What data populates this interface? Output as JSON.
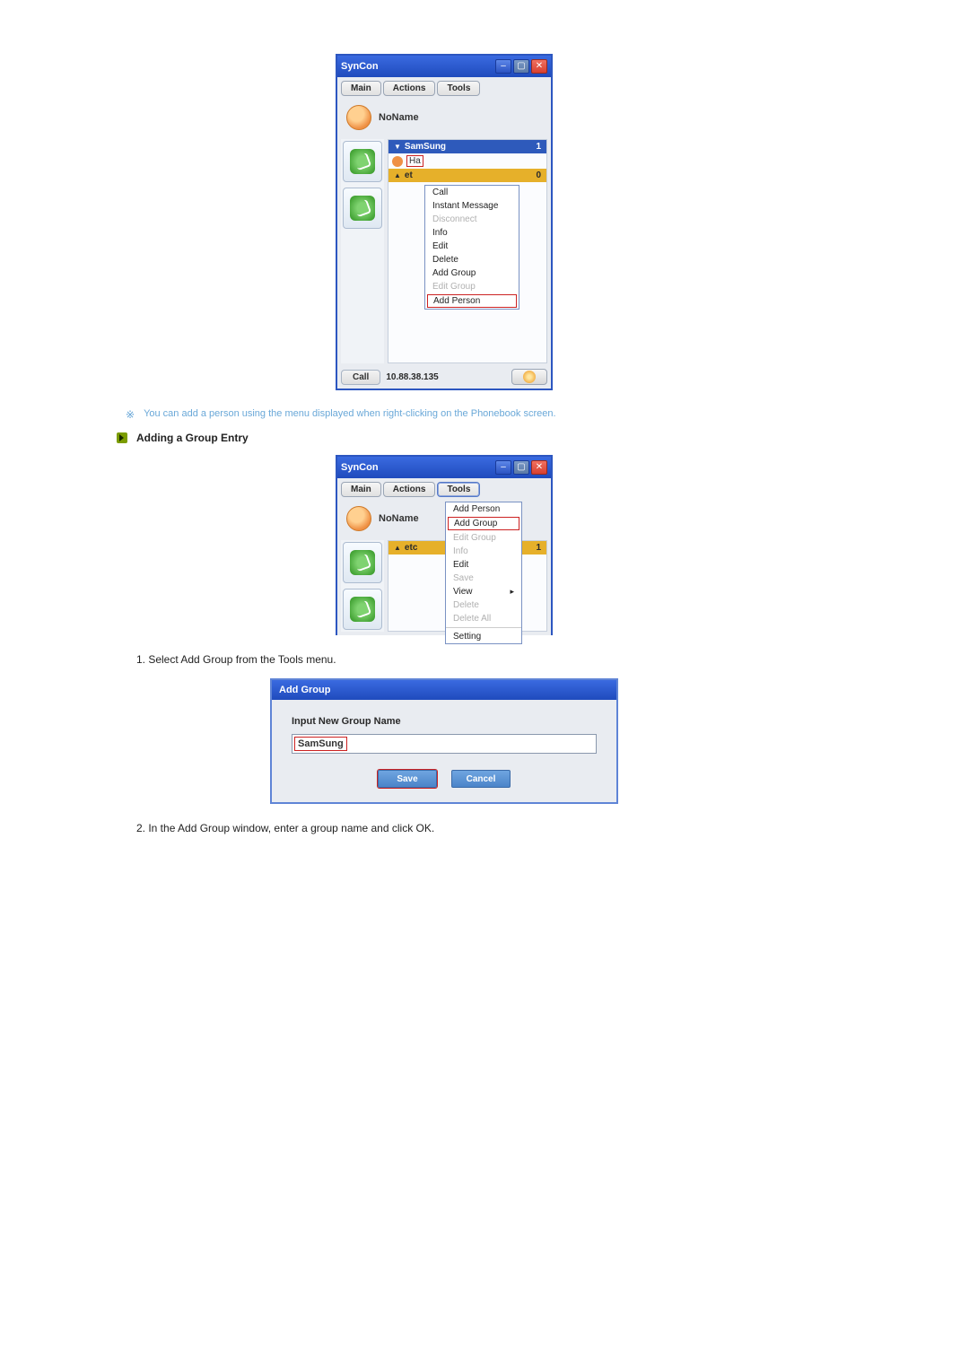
{
  "win1": {
    "title": "SynCon",
    "menu": {
      "main": "Main",
      "actions": "Actions",
      "tools": "Tools"
    },
    "profile_name": "NoName",
    "group": {
      "name": "SamSung",
      "count": "1"
    },
    "contact_label": "Ha",
    "etc_group": {
      "label": "et",
      "count": "0"
    },
    "ctx": {
      "call": "Call",
      "im": "Instant Message",
      "disconnect": "Disconnect",
      "info": "Info",
      "edit": "Edit",
      "delete": "Delete",
      "add_group": "Add Group",
      "edit_group": "Edit Group",
      "add_person": "Add Person"
    },
    "status_label": "Call",
    "status_ip": "10.88.38.135"
  },
  "note": "You can add a person using the menu displayed when right-clicking on the Phonebook screen.",
  "heading": "Adding a Group Entry",
  "win2": {
    "title": "SynCon",
    "menu": {
      "main": "Main",
      "actions": "Actions",
      "tools": "Tools"
    },
    "profile_name": "NoName",
    "etc_label": "etc",
    "etc_count": "1",
    "tools_menu": {
      "add_person": "Add Person",
      "add_group": "Add Group",
      "edit_group": "Edit Group",
      "info": "Info",
      "edit": "Edit",
      "save": "Save",
      "view": "View",
      "delete": "Delete",
      "delete_all": "Delete All",
      "setting": "Setting"
    }
  },
  "step1": "1. Select Add Group from the Tools menu.",
  "dlg": {
    "title": "Add Group",
    "label": "Input New Group Name",
    "input_value": "SamSung",
    "save": "Save",
    "cancel": "Cancel"
  },
  "step2": "2. In the Add Group window, enter a group name and click OK."
}
